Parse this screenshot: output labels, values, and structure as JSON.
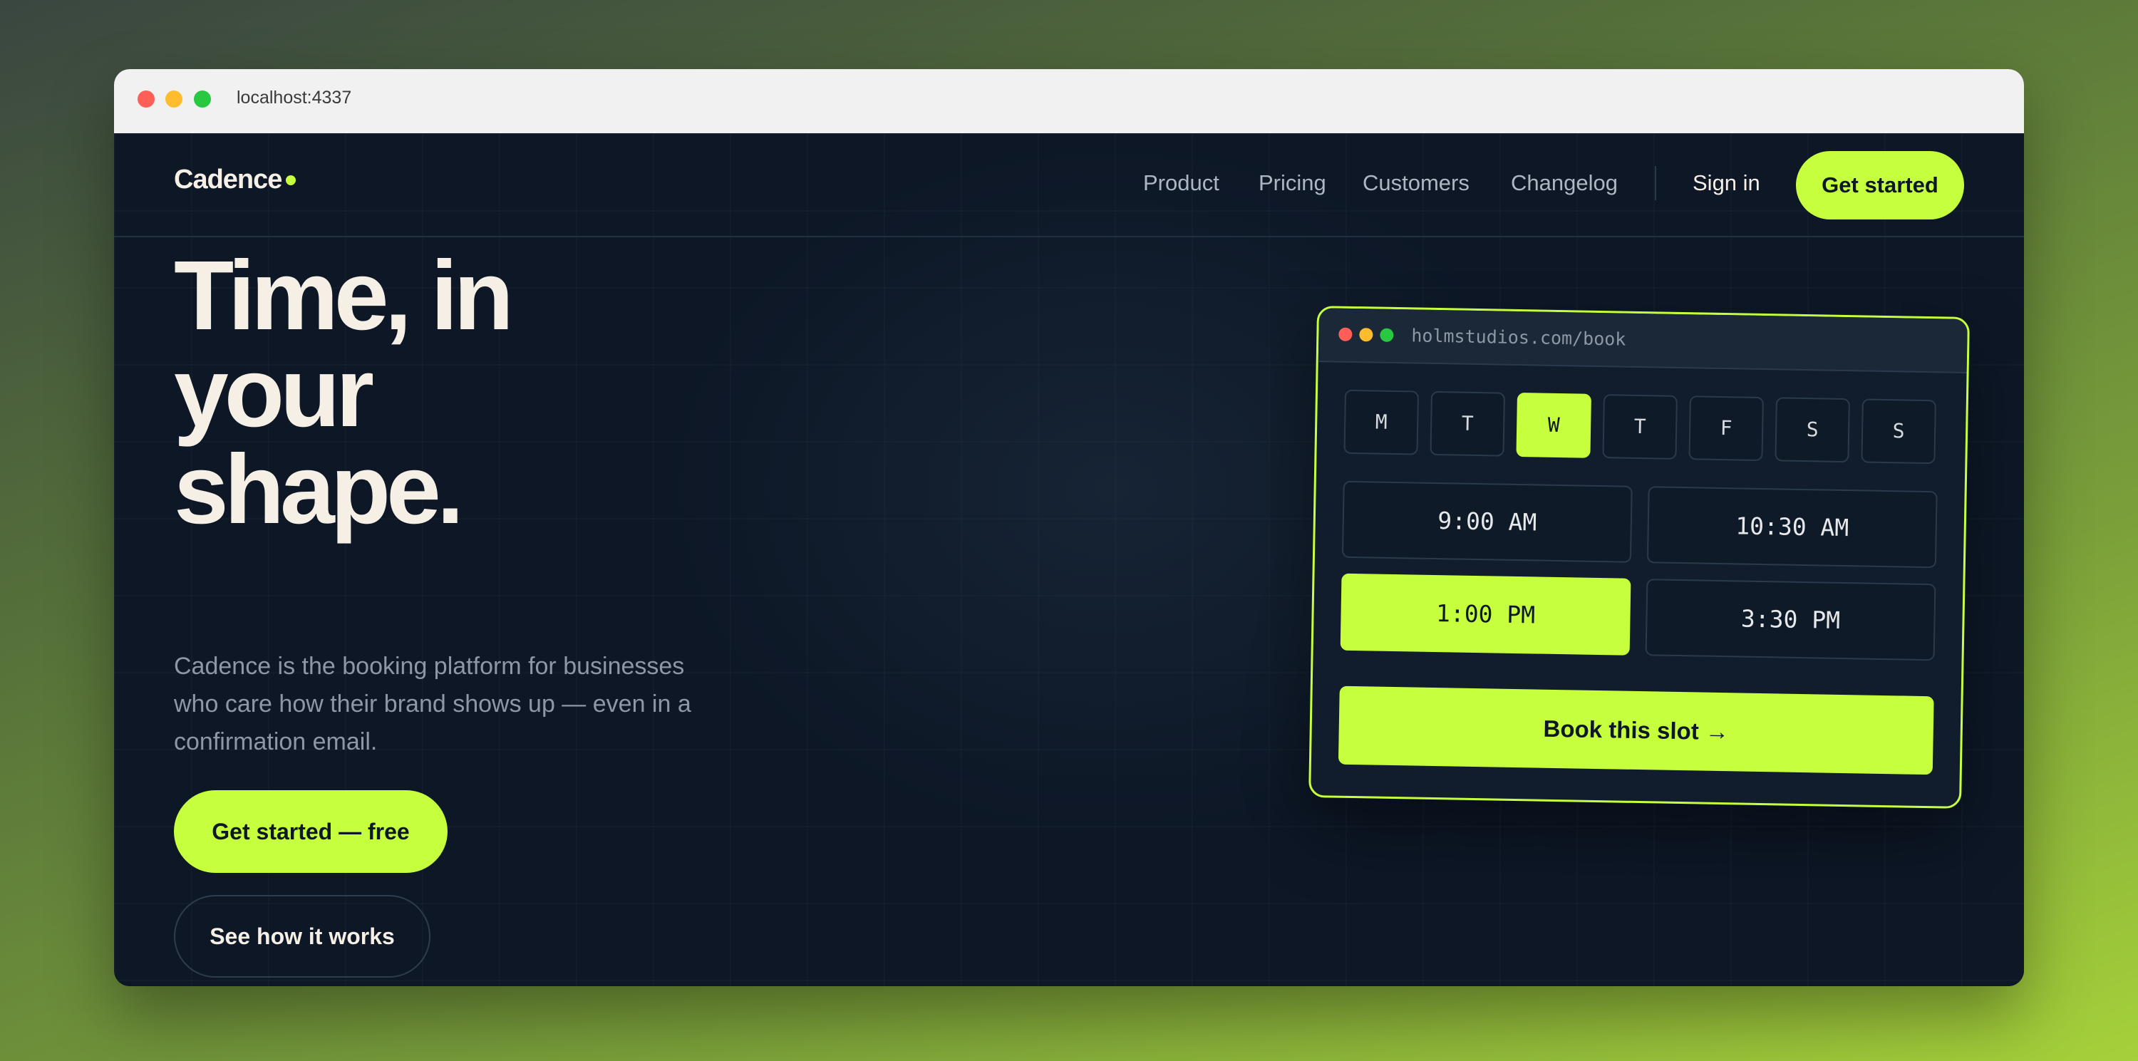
{
  "browser": {
    "url": "localhost:4337"
  },
  "nav": {
    "logo": "Cadence",
    "links": [
      "Product",
      "Pricing",
      "Customers",
      "Changelog"
    ],
    "signin": "Sign in",
    "cta": "Get started"
  },
  "hero": {
    "headline": [
      "Time, in",
      "your",
      "shape."
    ],
    "subtitle": "Cadence is the booking platform for businesses who care how their brand shows up — even in a confirmation email.",
    "primary_cta": "Get started — free",
    "secondary_cta": "See how it works"
  },
  "booking_card": {
    "url": "holmstudios.com/book",
    "days": [
      "M",
      "T",
      "W",
      "T",
      "F",
      "S",
      "S"
    ],
    "selected_day": "W",
    "slots": [
      "9:00 AM",
      "10:30 AM",
      "1:00 PM",
      "3:30 PM"
    ],
    "selected_slot": "1:00 PM",
    "book_label": "Book this slot →"
  },
  "colors": {
    "accent": "#c6ff3d",
    "background": "#0d1726",
    "text": "#f5efe6"
  }
}
